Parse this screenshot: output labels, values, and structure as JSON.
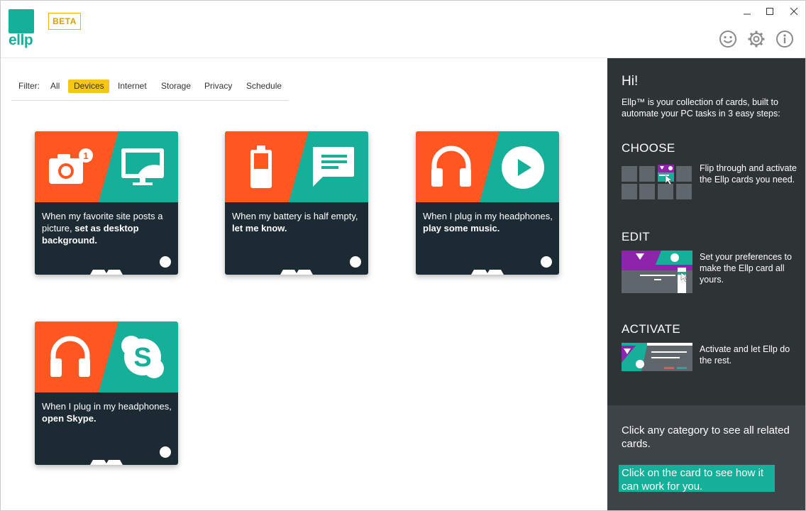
{
  "app": {
    "logo_text": "ellp",
    "beta_label": "BETA",
    "brand_color": "#16b09a",
    "accent_orange": "#ff5722",
    "card_dark": "#1c2a33"
  },
  "window_controls": {
    "minimize": "—",
    "maximize": "☐",
    "close": "✕"
  },
  "header_icons": [
    "smiley-icon",
    "gear-icon",
    "info-icon"
  ],
  "filter": {
    "label": "Filter:",
    "items": [
      "All",
      "Devices",
      "Internet",
      "Storage",
      "Privacy",
      "Schedule"
    ],
    "active": "Devices"
  },
  "cards": [
    {
      "left_icon": "camera-icon",
      "left_badge": "1",
      "right_icon": "monitor-icon",
      "text_plain": "When my favorite site posts a picture, ",
      "text_bold": "set as desktop background."
    },
    {
      "left_icon": "battery-icon",
      "right_icon": "message-icon",
      "text_plain": "When my battery is half empty, ",
      "text_bold": "let me know."
    },
    {
      "left_icon": "headphones-icon",
      "right_icon": "play-icon",
      "text_plain": "When I plug in my headphones, ",
      "text_bold": "play some music."
    },
    {
      "left_icon": "headphones-icon",
      "right_icon": "skype-icon",
      "text_plain": "When I plug in my headphones, ",
      "text_bold": "open Skype."
    }
  ],
  "panel": {
    "greeting": "Hi!",
    "intro": "Ellp™ is your collection of cards, built to automate your PC tasks in 3 easy steps:",
    "steps": [
      {
        "title": "CHOOSE",
        "desc": "Flip through and activate the Ellp cards you need."
      },
      {
        "title": "EDIT",
        "desc": "Set your preferences to make the Ellp card all yours."
      },
      {
        "title": "ACTIVATE",
        "desc": "Activate and let Ellp do the rest."
      }
    ],
    "category_hint": "Click any category to see all related cards.",
    "card_hint": "Click on the card to see how it can work for you."
  }
}
